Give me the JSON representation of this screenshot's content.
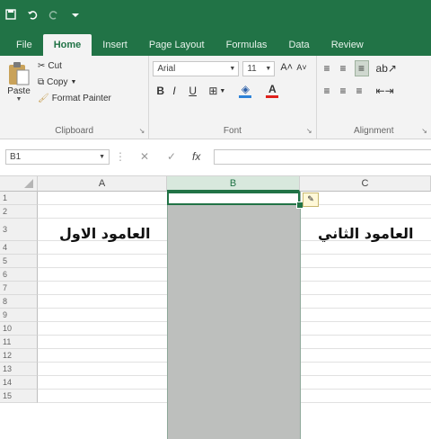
{
  "quick_access": [
    "save-icon",
    "undo-icon",
    "redo-icon",
    "customize-qat-icon"
  ],
  "tabs": [
    {
      "label": "File"
    },
    {
      "label": "Home"
    },
    {
      "label": "Insert"
    },
    {
      "label": "Page Layout"
    },
    {
      "label": "Formulas"
    },
    {
      "label": "Data"
    },
    {
      "label": "Review"
    }
  ],
  "ribbon": {
    "clipboard": {
      "label": "Clipboard",
      "paste": "Paste",
      "cut": "Cut",
      "copy": "Copy",
      "format_painter": "Format Painter"
    },
    "font": {
      "label": "Font",
      "font_name": "Arial",
      "font_size": "11",
      "grow": "A˄",
      "shrink": "A˅",
      "bold": "B",
      "italic": "I",
      "underline": "U"
    },
    "alignment": {
      "label": "Alignment"
    }
  },
  "formula_bar": {
    "name_box": "B1",
    "fx": "fx",
    "content": ""
  },
  "sheet": {
    "columns": [
      "A",
      "B",
      "C"
    ],
    "selected_column": "B",
    "rows": [
      "1",
      "2",
      "3",
      "4",
      "5",
      "6",
      "7",
      "8",
      "9",
      "10",
      "11",
      "12",
      "13",
      "14",
      "15"
    ],
    "cells": {
      "A3": "العامود الاول",
      "C3": "العامود الثاني"
    }
  },
  "colors": {
    "accent": "#217346",
    "selection": "#bdbfbd"
  }
}
